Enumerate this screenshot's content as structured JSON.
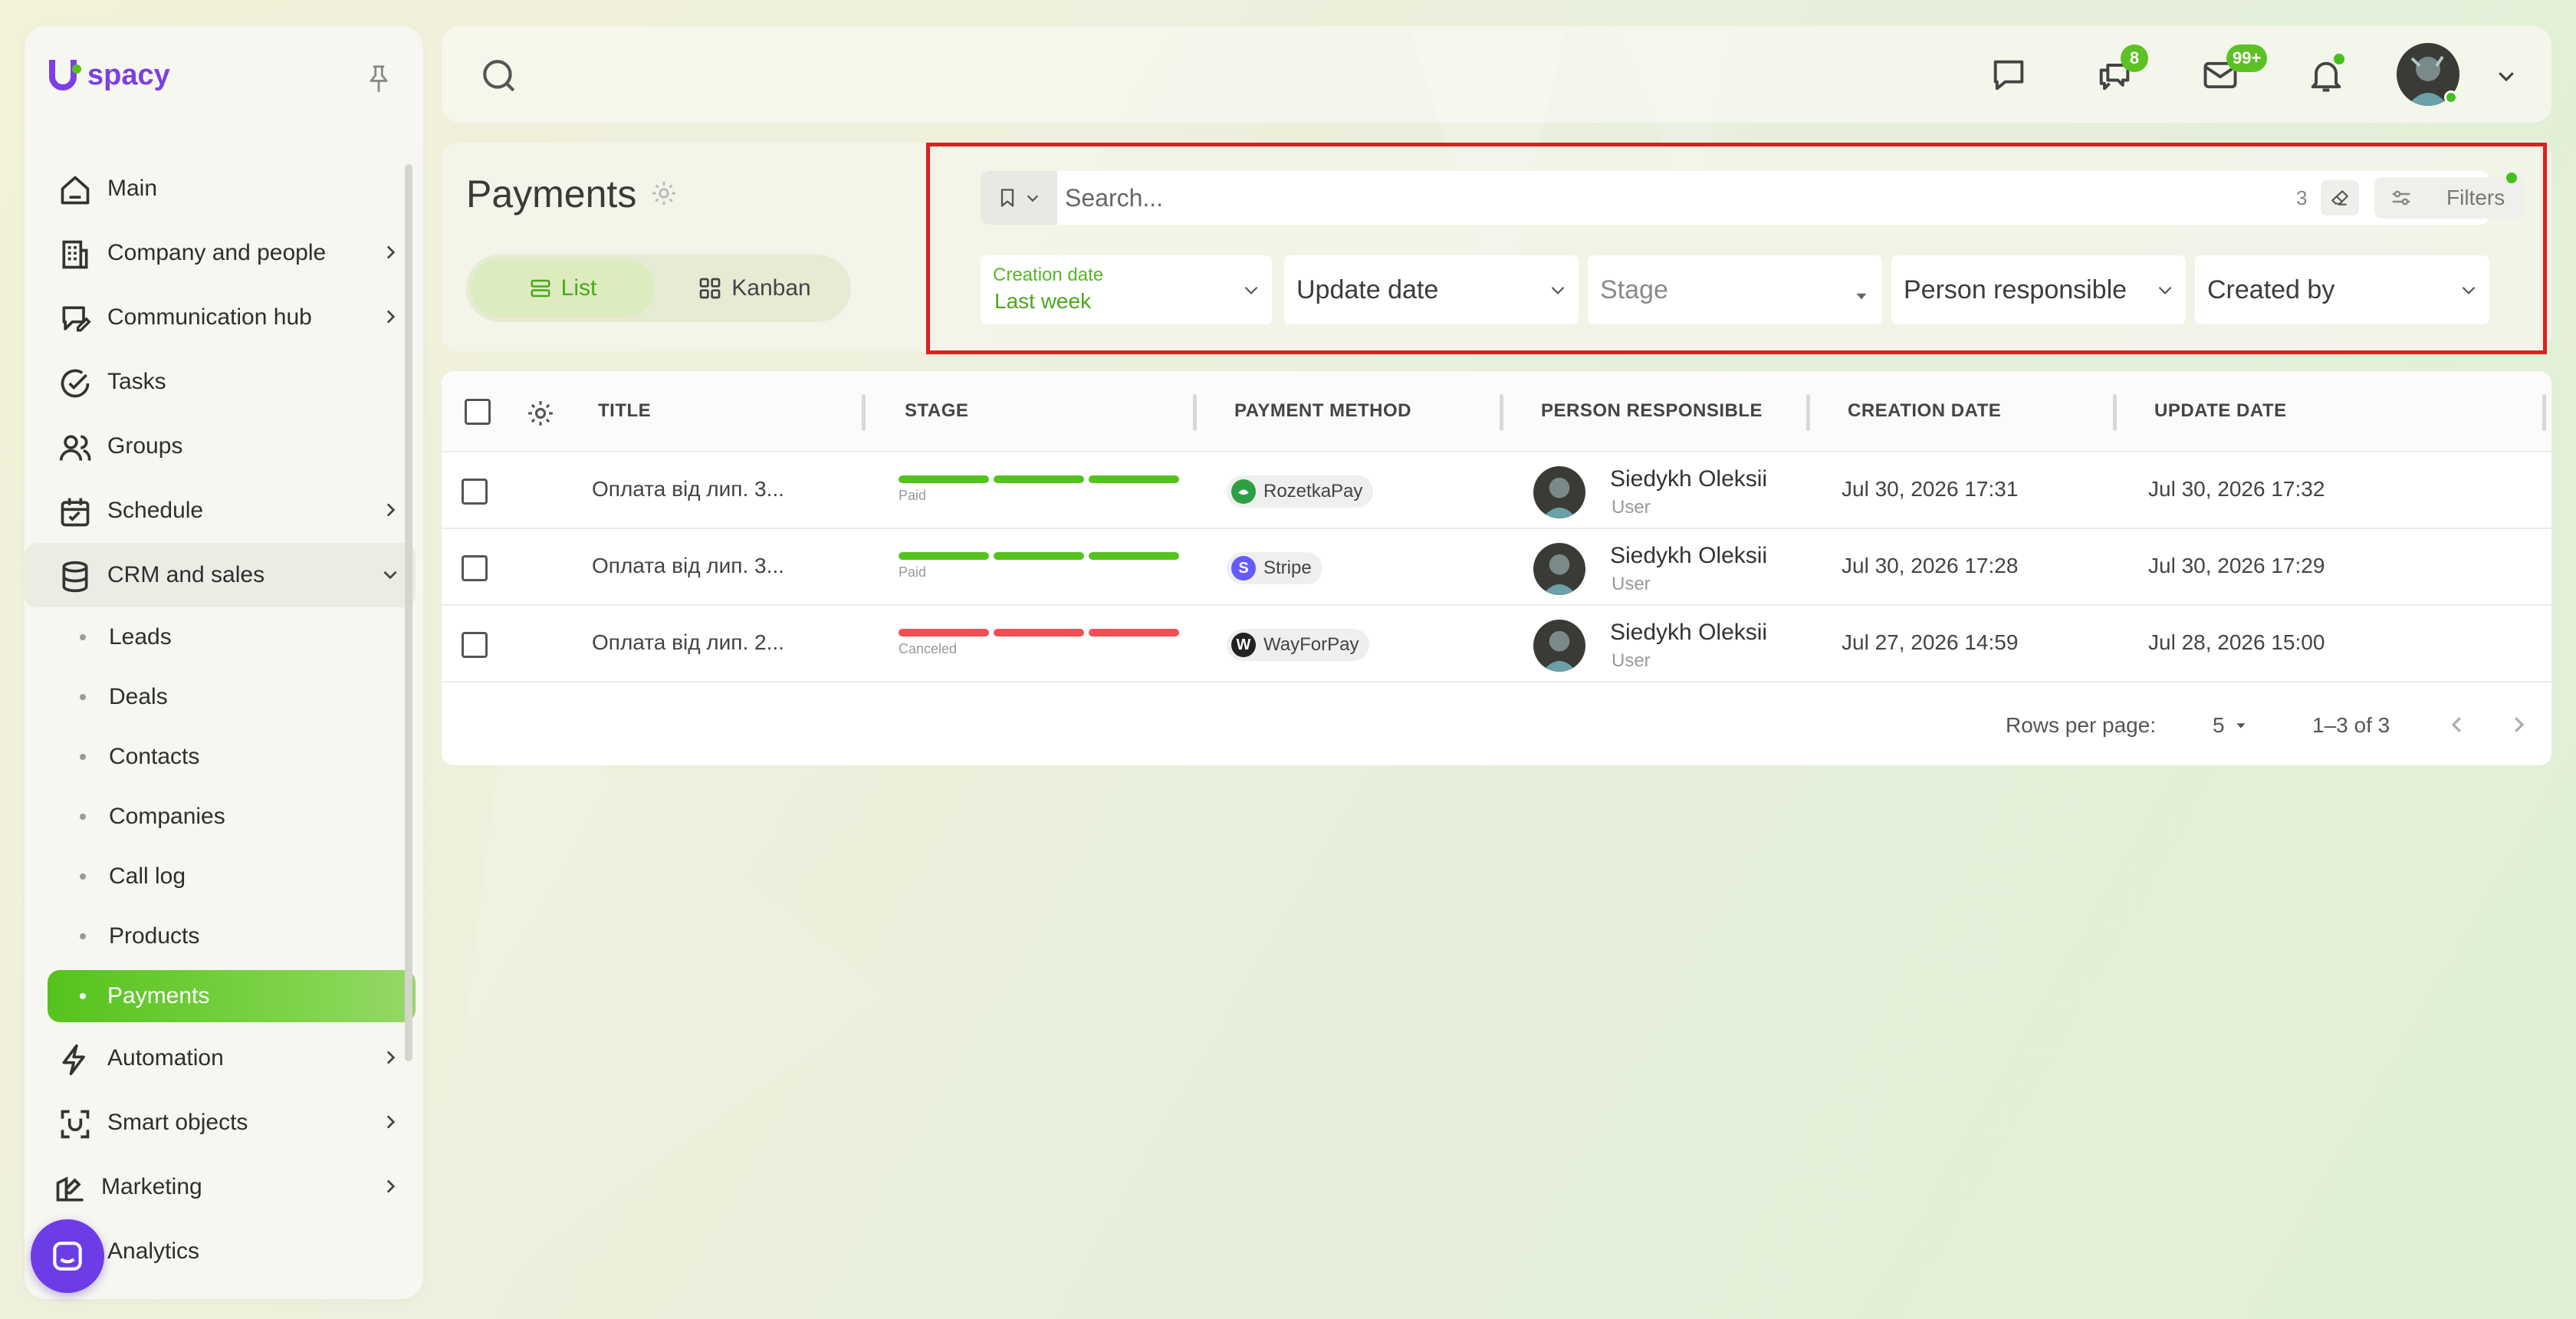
{
  "app": {
    "logo_text": "spacy",
    "brand_color": "#7b3fe4",
    "accent_color": "#5cc124"
  },
  "sidebar": {
    "items": [
      {
        "label": "Main",
        "icon": "home-icon",
        "has_chevron": false
      },
      {
        "label": "Company and people",
        "icon": "building-icon",
        "has_chevron": true
      },
      {
        "label": "Communication hub",
        "icon": "chat-edit-icon",
        "has_chevron": true
      },
      {
        "label": "Tasks",
        "icon": "check-circle-icon",
        "has_chevron": false
      },
      {
        "label": "Groups",
        "icon": "users-icon",
        "has_chevron": false
      },
      {
        "label": "Schedule",
        "icon": "calendar-icon",
        "has_chevron": true
      },
      {
        "label": "CRM and sales",
        "icon": "database-icon",
        "has_chevron": true,
        "expanded": true
      }
    ],
    "crm_subitems": [
      "Leads",
      "Deals",
      "Contacts",
      "Companies",
      "Call log",
      "Products",
      "Payments"
    ],
    "active_subitem": "Payments",
    "items_after": [
      {
        "label": "Automation",
        "icon": "lightning-icon",
        "has_chevron": true
      },
      {
        "label": "Smart objects",
        "icon": "scan-icon",
        "has_chevron": true
      },
      {
        "label": "Marketing",
        "icon": "marketing-icon",
        "has_chevron": true
      },
      {
        "label": "Analytics",
        "icon": "analytics-icon",
        "has_chevron": false
      }
    ]
  },
  "topbar": {
    "chat_badge": "8",
    "mail_badge": "99+"
  },
  "page": {
    "title": "Payments",
    "views": {
      "list": "List",
      "kanban": "Kanban"
    },
    "active_view": "list"
  },
  "filters": {
    "search_placeholder": "Search...",
    "active_count": "3",
    "filters_label": "Filters",
    "creation_date_label": "Creation date",
    "creation_date_value": "Last week",
    "update_date": "Update date",
    "stage": "Stage",
    "person_responsible": "Person responsible",
    "created_by": "Created by"
  },
  "table": {
    "columns": [
      "TITLE",
      "STAGE",
      "PAYMENT METHOD",
      "PERSON RESPONSIBLE",
      "CREATION DATE",
      "UPDATE DATE"
    ],
    "rows": [
      {
        "title": "Оплата від лип. 3...",
        "stage": "Paid",
        "stage_color": "#55c31d",
        "payment_method": "RozetkaPay",
        "payment_icon_color": "#2ea043",
        "person_name": "Siedykh Oleksii",
        "person_role": "User",
        "creation_date": "Jul 30, 2026 17:31",
        "update_date": "Jul 30, 2026 17:32"
      },
      {
        "title": "Оплата від лип. 3...",
        "stage": "Paid",
        "stage_color": "#55c31d",
        "payment_method": "Stripe",
        "payment_icon_color": "#635bff",
        "payment_icon_letter": "S",
        "person_name": "Siedykh Oleksii",
        "person_role": "User",
        "creation_date": "Jul 30, 2026 17:28",
        "update_date": "Jul 30, 2026 17:29"
      },
      {
        "title": "Оплата від лип. 2...",
        "stage": "Canceled",
        "stage_color": "#ef4f55",
        "payment_method": "WayForPay",
        "payment_icon_color": "#222222",
        "payment_icon_letter": "W",
        "person_name": "Siedykh Oleksii",
        "person_role": "User",
        "creation_date": "Jul 27, 2026 14:59",
        "update_date": "Jul 28, 2026 15:00"
      }
    ]
  },
  "pagination": {
    "rows_per_page_label": "Rows per page:",
    "rows_per_page": "5",
    "range": "1–3 of 3"
  }
}
